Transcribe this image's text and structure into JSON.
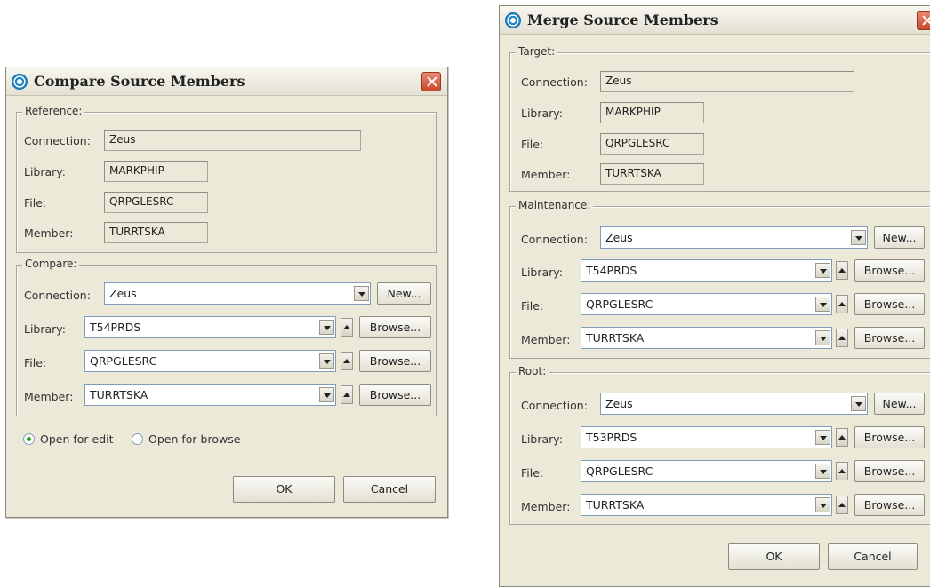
{
  "compare_dialog": {
    "title": "Compare Source Members",
    "reference_group": {
      "legend": "Reference:",
      "connection_label": "Connection:",
      "connection_value": "Zeus",
      "library_label": "Library:",
      "library_value": "MARKPHIP",
      "file_label": "File:",
      "file_value": "QRPGLESRC",
      "member_label": "Member:",
      "member_value": "TURRTSKA"
    },
    "compare_group": {
      "legend": "Compare:",
      "connection_label": "Connection:",
      "connection_value": "Zeus",
      "new_label": "New...",
      "library_label": "Library:",
      "library_value": "T54PRDS",
      "file_label": "File:",
      "file_value": "QRPGLESRC",
      "member_label": "Member:",
      "member_value": "TURRTSKA",
      "browse_label": "Browse..."
    },
    "open_for_edit": "Open for edit",
    "open_for_browse": "Open for browse",
    "ok_label": "OK",
    "cancel_label": "Cancel"
  },
  "merge_dialog": {
    "title": "Merge Source Members",
    "target_group": {
      "legend": "Target:",
      "connection_label": "Connection:",
      "connection_value": "Zeus",
      "library_label": "Library:",
      "library_value": "MARKPHIP",
      "file_label": "File:",
      "file_value": "QRPGLESRC",
      "member_label": "Member:",
      "member_value": "TURRTSKA"
    },
    "maintenance_group": {
      "legend": "Maintenance:",
      "connection_label": "Connection:",
      "connection_value": "Zeus",
      "new_label": "New...",
      "library_label": "Library:",
      "library_value": "T54PRDS",
      "file_label": "File:",
      "file_value": "QRPGLESRC",
      "member_label": "Member:",
      "member_value": "TURRTSKA",
      "browse_label": "Browse..."
    },
    "root_group": {
      "legend": "Root:",
      "connection_label": "Connection:",
      "connection_value": "Zeus",
      "new_label": "New...",
      "library_label": "Library:",
      "library_value": "T53PRDS",
      "file_label": "File:",
      "file_value": "QRPGLESRC",
      "member_label": "Member:",
      "member_value": "TURRTSKA",
      "browse_label": "Browse..."
    },
    "ok_label": "OK",
    "cancel_label": "Cancel"
  }
}
